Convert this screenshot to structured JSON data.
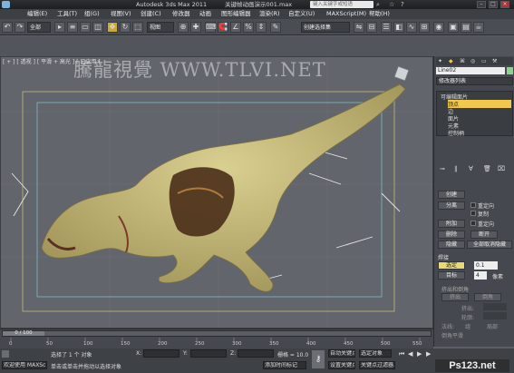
{
  "titlebar": {
    "title": "Autodesk 3ds Max  2011",
    "file": "关键帧动画演示001.max",
    "search_placeholder": "键入关键字或短语"
  },
  "menu": [
    "编辑(E)",
    "工具(T)",
    "组(G)",
    "视图(V)",
    "创建(C)",
    "修改器",
    "动画",
    "图形编辑器",
    "渲染(R)",
    "自定义(U)",
    "MAXScript(M)",
    "帮助(H)"
  ],
  "toolbar": {
    "filter": "全部",
    "ref_coord": "视图",
    "selection_set": "创建选择集"
  },
  "viewport": {
    "label": "[ + ] [ 透视 ] [ 平滑 + 高光 ] [ 已启用 ]",
    "watermark": "騰龍視覺 WWW.TLVI.NET"
  },
  "panel": {
    "object_name": "Line02",
    "modifier_list": "修改器列表",
    "stack": [
      "可编辑面片",
      "顶点",
      "边",
      "面片",
      "元素",
      "控制柄"
    ],
    "section_create": "创建",
    "btn_split": "分离",
    "chk_reorient": "重定向",
    "chk_copy": "复制",
    "btn_attach": "附加",
    "chk_reorient2": "重定向",
    "btn_delete": "删除",
    "btn_break": "断开",
    "btn_hide": "隐藏",
    "btn_unhide_all": "全部取消隐藏",
    "section_weld": "焊接",
    "btn_selected": "选定",
    "weld_value": "0.1",
    "btn_target": "目标",
    "target_value": "4",
    "target_unit": "像素",
    "section_extrude": "挤出和倒角",
    "btn_extrude": "挤出",
    "btn_bevel": "倒角",
    "label_extrude": "挤出:",
    "label_outline": "轮廓:",
    "label_normal": "法线:",
    "opt_group": "组",
    "opt_local": "局部",
    "label_bevel_smooth": "倒角平滑"
  },
  "timeline": {
    "frame": "0 / 100",
    "ticks": [
      "0",
      "50",
      "100",
      "150",
      "200",
      "250",
      "300",
      "350",
      "400",
      "450",
      "500",
      "550"
    ]
  },
  "status": {
    "mode": "欢迎使用  MAXSc",
    "selection": "选择了 1 个 对象",
    "hint": "单击或单击并拖动以选择对象",
    "x_label": "X:",
    "y_label": "Y:",
    "z_label": "Z:",
    "grid": "栅格 = 10.0",
    "add_tag": "添加时间标记",
    "auto_key": "自动关键点",
    "selected_obj": "选定对象",
    "set_key": "设置关键点",
    "key_filter": "关键点过滤器..."
  },
  "branding": {
    "ps123": "Ps123.net"
  }
}
